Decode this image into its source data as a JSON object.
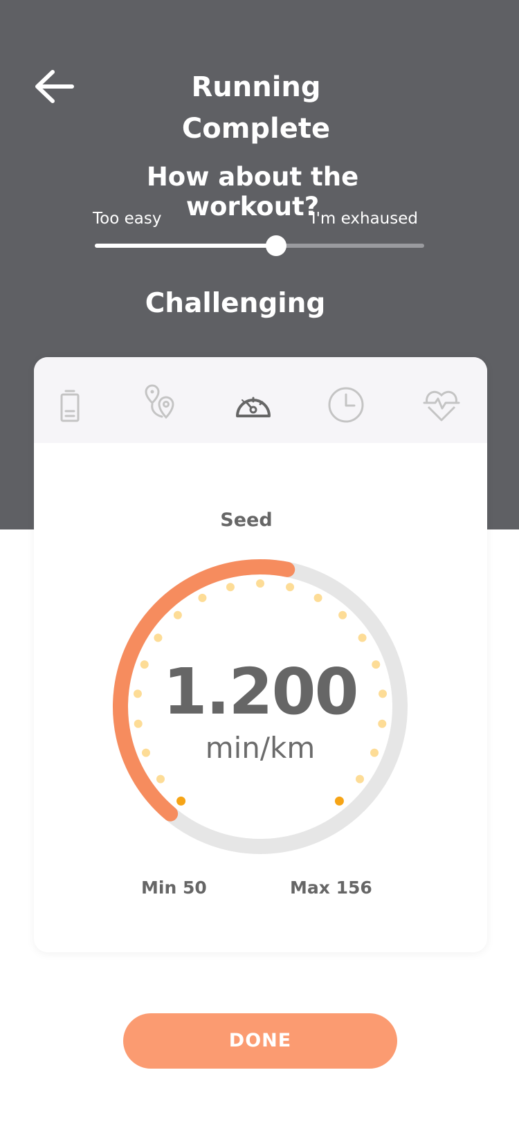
{
  "header": {
    "title": "Running Complete",
    "back_icon": "arrow-left-icon",
    "background_color": "#5f6064"
  },
  "feedback": {
    "question": "How about the workout?",
    "min_label": "Too easy",
    "max_label": "I'm exhaused",
    "slider_value": 0.55,
    "level_label": "Challenging"
  },
  "tabs": [
    {
      "name": "battery",
      "icon": "battery-icon",
      "active": false
    },
    {
      "name": "route",
      "icon": "location-pins-icon",
      "active": false
    },
    {
      "name": "speed",
      "icon": "speedometer-icon",
      "active": true
    },
    {
      "name": "time",
      "icon": "clock-icon",
      "active": false
    },
    {
      "name": "heart-rate",
      "icon": "heart-rate-icon",
      "active": false
    }
  ],
  "metric": {
    "label": "Seed",
    "value": "1.200",
    "unit": "min/km",
    "min_text": "Min 50",
    "max_text": "Max 156",
    "gauge_progress": 0.42
  },
  "actions": {
    "done_label": "DONE"
  },
  "colors": {
    "accent": "#fb9b71",
    "gauge_arc": "#f68c5e",
    "gauge_track": "#e6e6e6",
    "dot_light": "#fddc96",
    "dot_dark": "#f6a416",
    "text_gray": "#666666"
  }
}
